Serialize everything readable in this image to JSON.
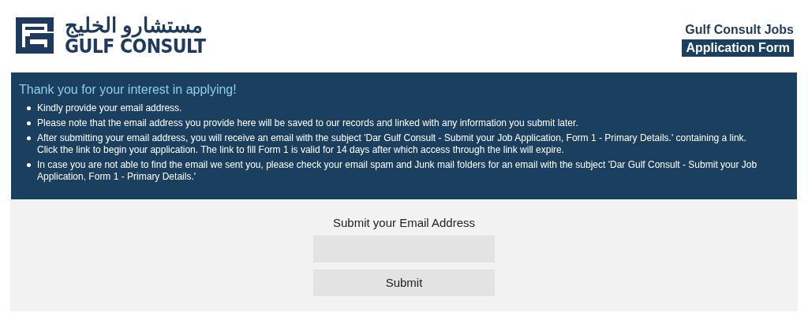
{
  "logo": {
    "arabic": "مستشارو الخليج",
    "latin": "GULF CONSULT"
  },
  "header": {
    "title": "Gulf Consult Jobs",
    "subtitle": "Application Form"
  },
  "notice": {
    "heading": "Thank you for your interest in applying!",
    "items": [
      "Kindly provide your email address.",
      "Please note that the email address you provide here will be saved to our records and linked with any information you submit later.",
      "After submitting your email address, you will receive an email with the subject 'Dar Gulf Consult - Submit your Job Application, Form 1 - Primary Details.' containing a link. Click the link to begin your application. The link to fill Form 1 is valid for 14 days after which access through the link will expire.",
      "In case you are not able to find the email we sent you, please check your email spam and Junk mail folders for an email with the subject 'Dar Gulf Consult - Submit your Job Application, Form 1 - Primary Details.'"
    ]
  },
  "form": {
    "label": "Submit your Email Address",
    "button": "Submit"
  }
}
